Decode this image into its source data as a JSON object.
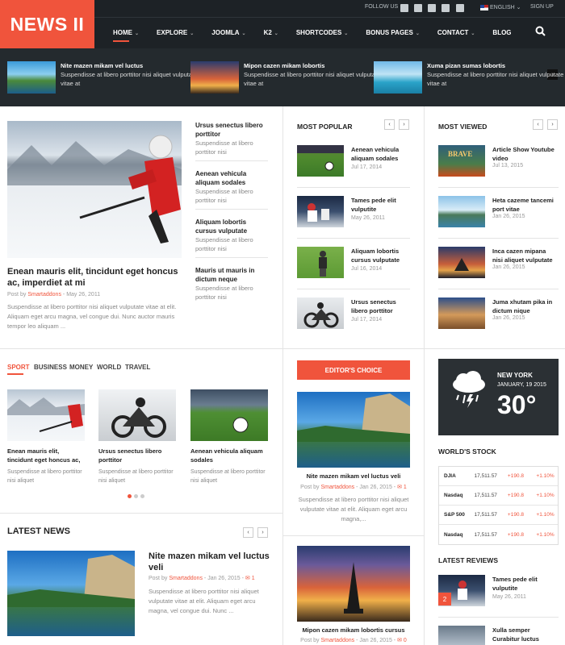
{
  "header": {
    "logo": "NEWS II",
    "follow": "FOLLOW US",
    "language": "ENGLISH",
    "signup": "SIGN UP",
    "nav": [
      "HOME",
      "EXPLORE",
      "JOOMLA",
      "K2",
      "SHORTCODES",
      "BONUS PAGES",
      "CONTACT",
      "BLOG"
    ]
  },
  "ticker": [
    {
      "title": "Nite mazen mikam vel luctus",
      "text": "Suspendisse at libero porttitor nisi aliquet vulputate vitae at"
    },
    {
      "title": "Mipon cazen mikam lobortis",
      "text": "Suspendisse at libero porttitor nisi aliquet vulputate vitae at"
    },
    {
      "title": "Xuma pizan sumas lobortis",
      "text": "Suspendisse at libero porttitor nisi aliquet vulputate vitae at"
    }
  ],
  "featured": {
    "title": "Enean mauris elit, tincidunt eget honcus ac, imperdiet at mi",
    "meta_prefix": "Post by",
    "author": "Smartaddons",
    "date": "May 26, 2011",
    "text": "Suspendisse at libero porttitor nisi aliquet vulputate vitae at elit. Aliquam eget arcu magna, vel congue dui. Nunc auctor mauris tempor leo aliquam ..."
  },
  "side_list": [
    {
      "title": "Ursus senectus libero porttitor",
      "text": "Suspendisse at libero porttitor nisi"
    },
    {
      "title": "Aenean vehicula aliquam sodales",
      "text": "Suspendisse at libero porttitor nisi"
    },
    {
      "title": "Aliquam lobortis cursus vulputate",
      "text": "Suspendisse at libero porttitor nisi"
    },
    {
      "title": "Mauris ut mauris in dictum neque",
      "text": "Suspendisse at libero porttitor nisi"
    }
  ],
  "most_popular": {
    "heading": "MOST POPULAR",
    "items": [
      {
        "title": "Aenean vehicula aliquam sodales",
        "date": "Jul 17, 2014"
      },
      {
        "title": "Tames pede elit vulputite",
        "date": "May 26, 2011"
      },
      {
        "title": "Aliquam lobortis cursus vulputate",
        "date": "Jul 16, 2014"
      },
      {
        "title": "Ursus senectus libero porttitor",
        "date": "Jul 17, 2014"
      }
    ]
  },
  "most_viewed": {
    "heading": "MOST VIEWED",
    "items": [
      {
        "title": "Article Show Youtube video",
        "date": "Jul 13, 2015"
      },
      {
        "title": "Heta cazeme tancemi port vitae",
        "date": "Jan 26, 2015"
      },
      {
        "title": "Inca cazen mipana nisi aliquet vulputate",
        "date": "Jan 26, 2015"
      },
      {
        "title": "Juma xhutam pika in dictum nique",
        "date": "Jan 26, 2015"
      }
    ]
  },
  "tabs": [
    "SPORT",
    "BUSINESS",
    "MONEY",
    "WORLD",
    "TRAVEL"
  ],
  "sport": [
    {
      "title": "Enean mauris elit, tincidunt eget honcus ac,",
      "text": "Suspendisse at libero porttitor nisi aliquet"
    },
    {
      "title": "Ursus senectus libero porttitor",
      "text": "Suspendisse at libero porttitor nisi aliquet"
    },
    {
      "title": "Aenean vehicula aliquam sodales",
      "text": "Suspendisse at libero porttitor nisi aliquet"
    }
  ],
  "editors_choice": {
    "heading": "EDITOR'S CHOICE",
    "items": [
      {
        "title": "Nite mazen mikam vel luctus veli",
        "meta_prefix": "Post by",
        "author": "Smartaddons",
        "date": "Jan 26, 2015",
        "comments": "1",
        "text": "Suspendisse at libero porttitor nisi aliquet vulputate vitae at elit. Aliquam eget arcu magna,..."
      },
      {
        "title": "Mipon cazen mikam lobortis cursus",
        "meta_prefix": "Post by",
        "author": "Smartaddons",
        "date": "Jan 26, 2015",
        "comments": "0"
      }
    ]
  },
  "latest_news": {
    "heading": "LATEST NEWS",
    "title": "Nite mazen mikam vel luctus veli",
    "meta_prefix": "Post by",
    "author": "Smartaddons",
    "date": "Jan 26, 2015",
    "comments": "1",
    "text": "Suspendisse at libero porttitor nisi aliquet vulputate vitae at elit. Aliquam eget arcu magna, vel congue dui. Nunc ..."
  },
  "weather": {
    "city": "NEW YORK",
    "date": "JANUARY, 19 2015",
    "temp": "30°"
  },
  "stock": {
    "heading": "WORLD'S STOCK",
    "rows": [
      {
        "name": "DJIA",
        "value": "17,511.57",
        "change": "+190.8",
        "pct": "+1.10%"
      },
      {
        "name": "Nasdaq",
        "value": "17,511.57",
        "change": "+190.8",
        "pct": "+1.10%"
      },
      {
        "name": "S&P 500",
        "value": "17,511.57",
        "change": "+190.8",
        "pct": "+1.10%"
      },
      {
        "name": "Nasdaq",
        "value": "17,511.57",
        "change": "+190.8",
        "pct": "+1.10%"
      }
    ]
  },
  "latest_reviews": {
    "heading": "LATEST REVIEWS",
    "items": [
      {
        "title": "Tames pede elit vulputite",
        "date": "May 26, 2011",
        "badge": "2"
      },
      {
        "title": "Xulla semper Curabitur luctus",
        "date": ""
      }
    ]
  },
  "colors": {
    "accent": "#f0543c",
    "header": "#1d2226"
  }
}
